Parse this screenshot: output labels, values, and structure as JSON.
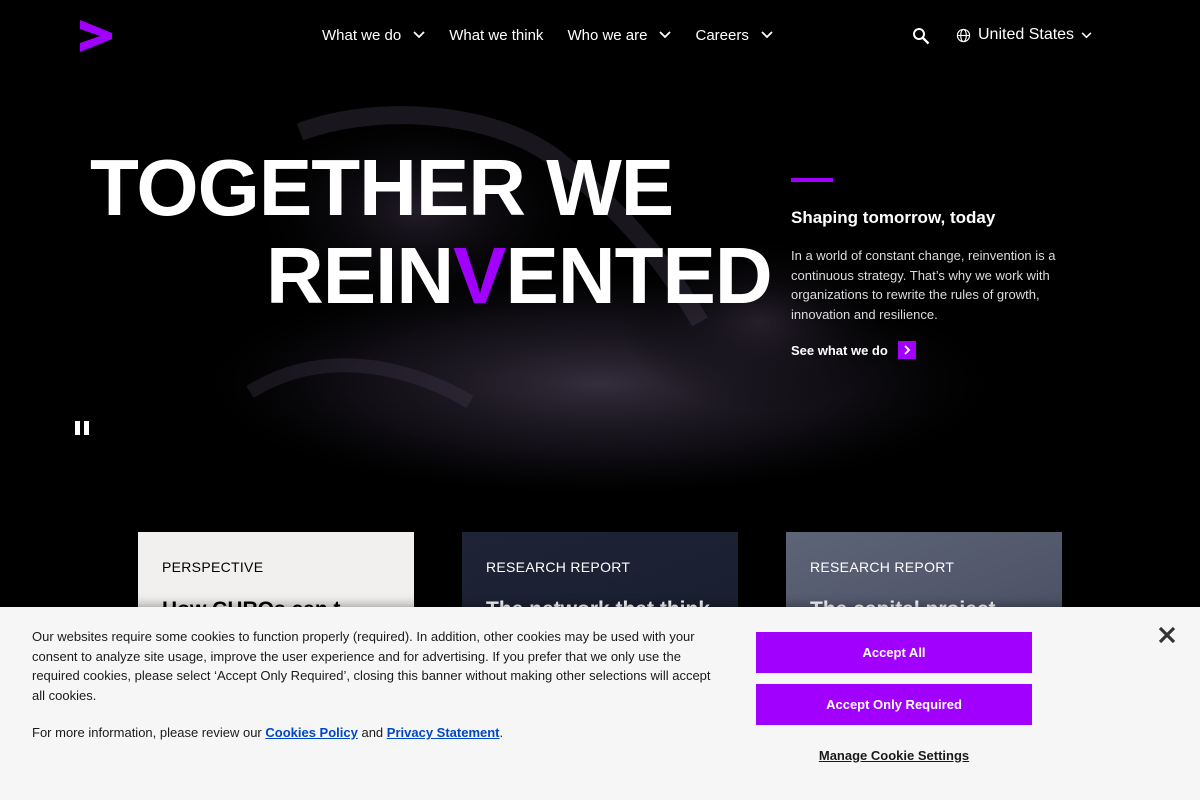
{
  "brand": {
    "logo_icon": "accenture-greater-than-logo",
    "accent_color": "#a100ff"
  },
  "nav": {
    "items": [
      {
        "label": "What we do",
        "has_dropdown": true
      },
      {
        "label": "What we think",
        "has_dropdown": false
      },
      {
        "label": "Who we are",
        "has_dropdown": true
      },
      {
        "label": "Careers",
        "has_dropdown": true
      }
    ],
    "search_icon": "search-icon",
    "country": {
      "label": "United States",
      "icon": "globe-icon"
    }
  },
  "hero": {
    "headline_line1": "TOGETHER WE",
    "headline_line2_before": "REIN",
    "headline_line2_accent": "V",
    "headline_line2_after": "ENTED",
    "subhead": "Shaping tomorrow, today",
    "body": "In a world of constant change, reinvention is a continuous strategy. That’s why we work with organizations to rewrite the rules of growth, innovation and resilience.",
    "cta_label": "See what we do",
    "pause_icon": "pause-icon"
  },
  "cards": [
    {
      "tag": "PERSPECTIVE",
      "title": "How CHROs can t"
    },
    {
      "tag": "RESEARCH REPORT",
      "title": "The network that think"
    },
    {
      "tag": "RESEARCH REPORT",
      "title": "The capital project"
    }
  ],
  "cookie": {
    "text": "Our websites require some cookies to function properly (required). In addition, other cookies may be used with your consent to analyze site usage, improve the user experience and for advertising. If you prefer that we only use the required cookies, please select ‘Accept Only Required’, closing this banner without making other selections will accept all cookies.",
    "more_prefix": "For more information, please review our ",
    "cookies_policy_link": "Cookies Policy",
    "more_middle": " and ",
    "privacy_link": "Privacy Statement",
    "more_suffix": ".",
    "accept_all": "Accept All",
    "accept_required": "Accept Only Required",
    "manage": "Manage Cookie Settings",
    "close_icon": "close-icon"
  }
}
